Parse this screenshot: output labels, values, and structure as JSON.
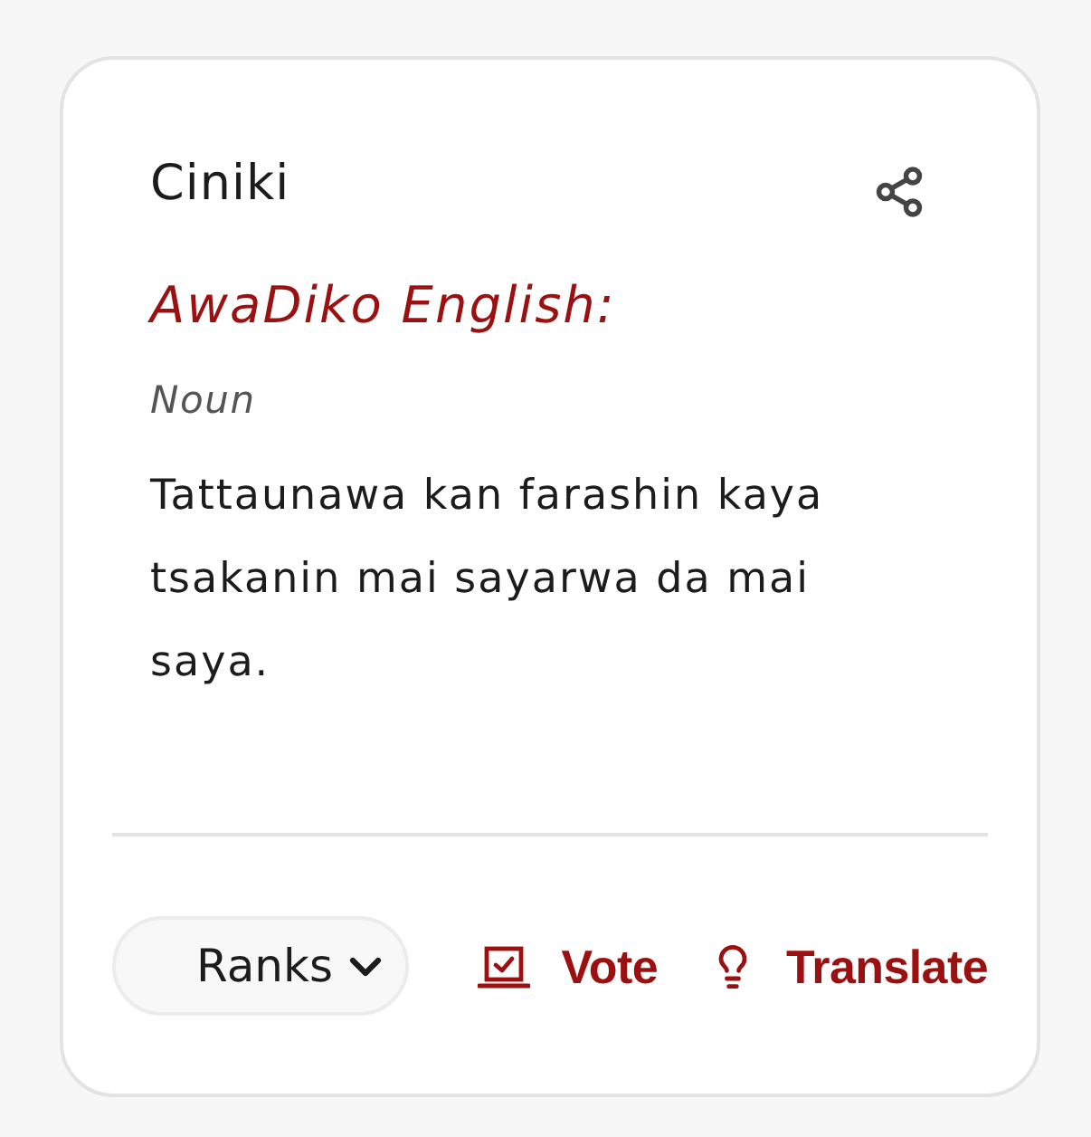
{
  "card": {
    "title": "Ciniki",
    "language": "AwaDiko English:",
    "part_of_speech": "Noun",
    "definition": "Tattaunawa kan farashin kaya tsakanin mai sayarwa da mai saya."
  },
  "actions": {
    "ranks": {
      "label": "Ranks"
    },
    "buttons": [
      {
        "kind": "vote",
        "label": "Vote"
      },
      {
        "kind": "translate",
        "label": "Translate"
      }
    ]
  }
}
